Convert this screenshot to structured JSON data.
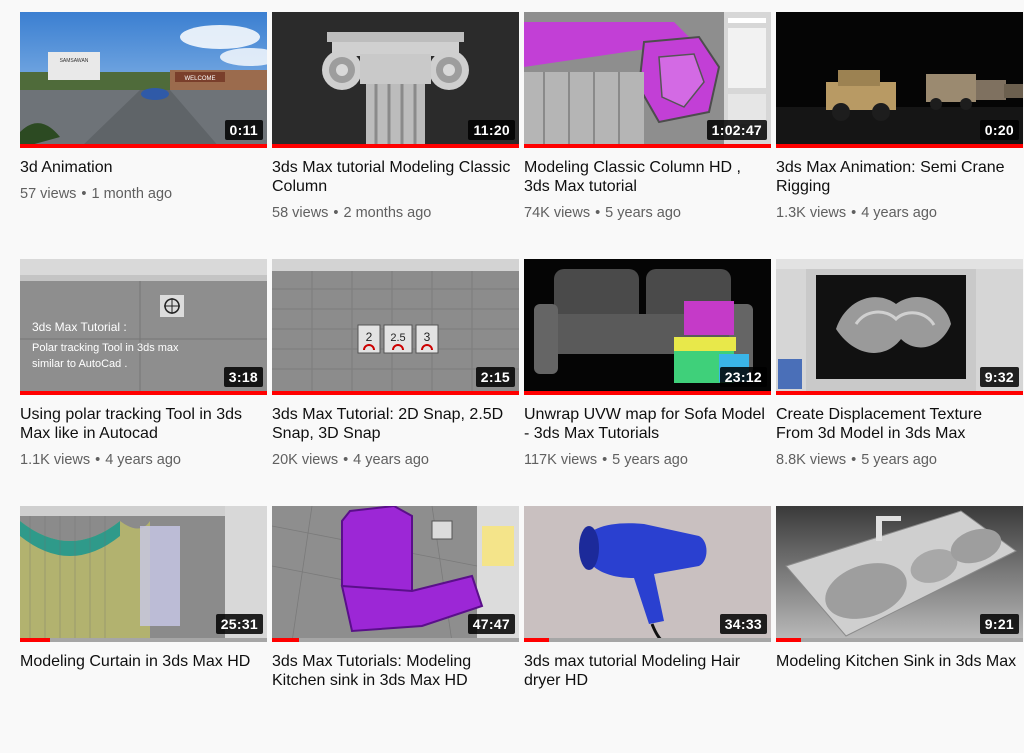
{
  "videos": [
    {
      "title": "3d Animation",
      "views": "57 views",
      "age": "1 month ago",
      "duration": "0:11",
      "progress": 1.0,
      "thumb": "scene"
    },
    {
      "title": "3ds Max tutorial Modeling Classic Column",
      "views": "58 views",
      "age": "2 months ago",
      "duration": "11:20",
      "progress": 1.0,
      "thumb": "column"
    },
    {
      "title": "Modeling Classic Column HD , 3ds Max tutorial",
      "views": "74K views",
      "age": "5 years ago",
      "duration": "1:02:47",
      "progress": 1.0,
      "thumb": "column-wire"
    },
    {
      "title": "3ds Max Animation: Semi Crane Rigging",
      "views": "1.3K views",
      "age": "4 years ago",
      "duration": "0:20",
      "progress": 1.0,
      "thumb": "trucks"
    },
    {
      "title": "Using polar tracking Tool in 3ds Max like in Autocad",
      "views": "1.1K views",
      "age": "4 years ago",
      "duration": "3:18",
      "progress": 1.0,
      "thumb": "polar"
    },
    {
      "title": "3ds Max Tutorial: 2D Snap, 2.5D Snap, 3D Snap",
      "views": "20K views",
      "age": "4 years ago",
      "duration": "2:15",
      "progress": 1.0,
      "thumb": "snap"
    },
    {
      "title": "Unwrap UVW map for Sofa Model - 3ds Max Tutorials",
      "views": "117K views",
      "age": "5 years ago",
      "duration": "23:12",
      "progress": 1.0,
      "thumb": "sofa"
    },
    {
      "title": "Create Displacement Texture From 3d Model in 3ds Max",
      "views": "8.8K views",
      "age": "5 years ago",
      "duration": "9:32",
      "progress": 1.0,
      "thumb": "ornament"
    },
    {
      "title": "Modeling Curtain in 3ds Max HD",
      "views": "",
      "age": "",
      "duration": "25:31",
      "progress": 0.12,
      "thumb": "curtain"
    },
    {
      "title": "3ds Max Tutorials: Modeling Kitchen sink in 3ds Max HD",
      "views": "",
      "age": "",
      "duration": "47:47",
      "progress": 0.11,
      "thumb": "pipe"
    },
    {
      "title": "3ds max tutorial Modeling Hair dryer HD",
      "views": "",
      "age": "",
      "duration": "34:33",
      "progress": 0.1,
      "thumb": "hairdryer"
    },
    {
      "title": "Modeling Kitchen Sink in 3ds Max",
      "views": "",
      "age": "",
      "duration": "9:21",
      "progress": 0.1,
      "thumb": "sink"
    }
  ],
  "thumb_text": {
    "scene_sign": "SAMSAWAN",
    "scene_welcome": "WELCOME",
    "polar_heading": "3ds Max Tutorial :",
    "polar_line1": "Polar tracking Tool in 3ds max",
    "polar_line2": "similar to AutoCad .",
    "snap_labels": [
      "2",
      "2.5",
      "3"
    ]
  },
  "colors": {
    "progress": "#ff0000",
    "progress_track": "#a6a6a6",
    "title": "#0f0f0f",
    "meta": "#606060"
  }
}
